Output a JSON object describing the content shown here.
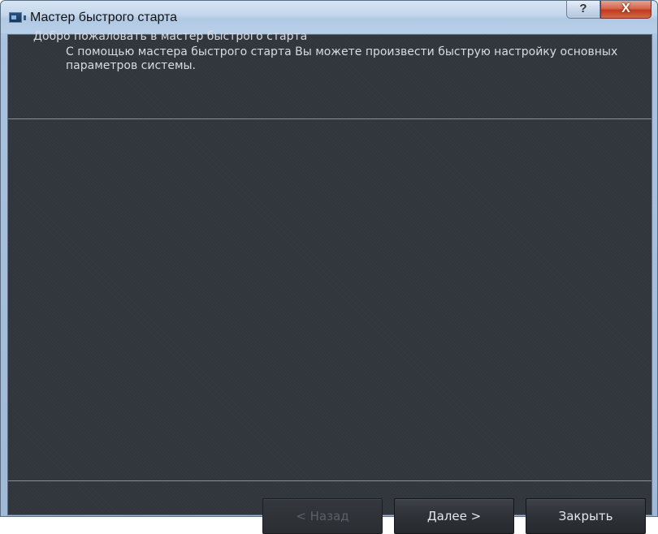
{
  "window": {
    "title": "Мастер быстрого старта",
    "help_label": "?",
    "close_label": "X"
  },
  "header": {
    "title": "Добро пожаловать в мастер быстрого старта",
    "description": "С помощью мастера быстрого старта Вы можете произвести быструю настройку основных параметров системы."
  },
  "buttons": {
    "back_label": "< Назад",
    "back_enabled": false,
    "next_label": "Далее >",
    "close_label": "Закрыть"
  },
  "colors": {
    "client_background": "#32363d",
    "text": "#d8dce2",
    "close_button": "#c03a1e",
    "titlebar": "#c3d6ec"
  },
  "icons": {
    "app": "app-window-icon",
    "help": "help-icon",
    "close": "close-icon"
  }
}
